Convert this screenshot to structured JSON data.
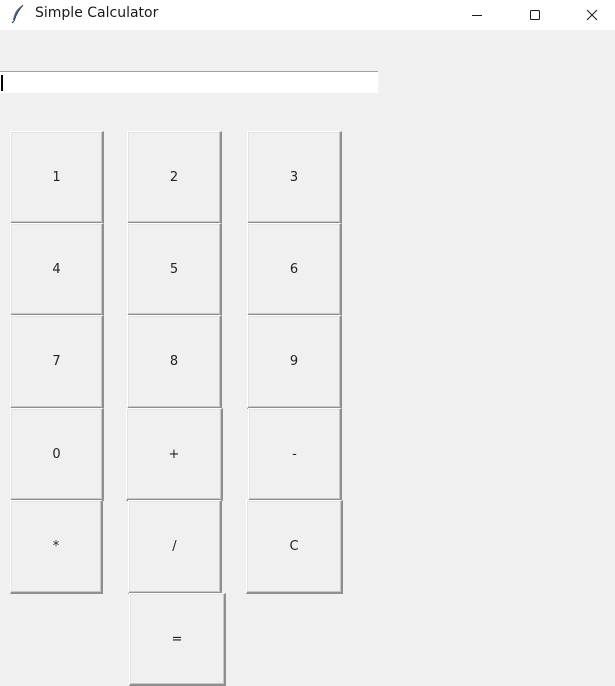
{
  "window": {
    "title": "Simple Calculator",
    "icon": "feather-icon",
    "controls": {
      "minimize": "minimize-icon",
      "maximize": "maximize-icon",
      "close": "close-icon"
    }
  },
  "display": {
    "value": ""
  },
  "keys": [
    "1",
    "2",
    "3",
    "4",
    "5",
    "6",
    "7",
    "8",
    "9",
    "0",
    "+",
    "-",
    "*",
    "/",
    "C",
    "="
  ]
}
